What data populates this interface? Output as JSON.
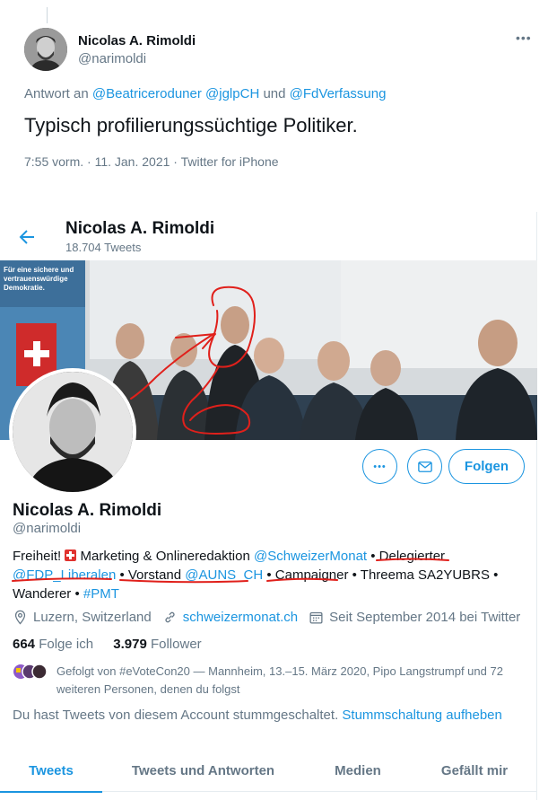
{
  "tweet": {
    "name": "Nicolas A. Rimoldi",
    "handle": "@narimoldi",
    "more": "•••",
    "reply_prefix": "Antwort an",
    "reply_to_1": "@Beatriceroduner",
    "reply_to_2": "@jglpCH",
    "reply_and": "und",
    "reply_to_3": "@FdVerfassung",
    "text": "Typisch profilierungssüchtige Politiker.",
    "meta": "7:55 vorm. · 11. Jan. 2021 · Twitter for iPhone"
  },
  "profile": {
    "title": "Nicolas A. Rimoldi",
    "tweet_count": "18.704 Tweets",
    "banner_sign": "Für eine sichere und vertrauenswürdige Demokratie.",
    "name": "Nicolas A. Rimoldi",
    "handle": "@narimoldi",
    "follow_label": "Folgen",
    "more": "•••",
    "bio": {
      "p1": "Freiheit! ",
      "p2": " Marketing & Onlineredaktion ",
      "l1": "@SchweizerMonat",
      "p3": " • Delegierter ",
      "l2": "@FDP_Liberalen",
      "p4": " • Vorstand ",
      "l3": "@AUNS_CH",
      "p5": " • Campaigner • Threema SA2YUBRS • Wanderer • ",
      "l4": "#PMT"
    },
    "location": "Luzern, Switzerland",
    "website": "schweizermonat.ch",
    "joined": "Seit September 2014 bei Twitter",
    "following_count": "664",
    "following_label": "Folge ich",
    "followers_count": "3.979",
    "followers_label": "Follower",
    "followed_by": "Gefolgt von #eVoteCon20 — Mannheim, 13.–15. März 2020, Pipo Langstrumpf und 72 weiteren Personen, denen du folgst",
    "muted_text": "Du hast Tweets von diesem Account stummgeschaltet.",
    "unmute_link": "Stummschaltung aufheben",
    "tabs": [
      "Tweets",
      "Tweets und Antworten",
      "Medien",
      "Gefällt mir"
    ]
  },
  "colors": {
    "accent": "#1b95e0",
    "muted": "#657786",
    "annotation_red": "#e0201b"
  }
}
